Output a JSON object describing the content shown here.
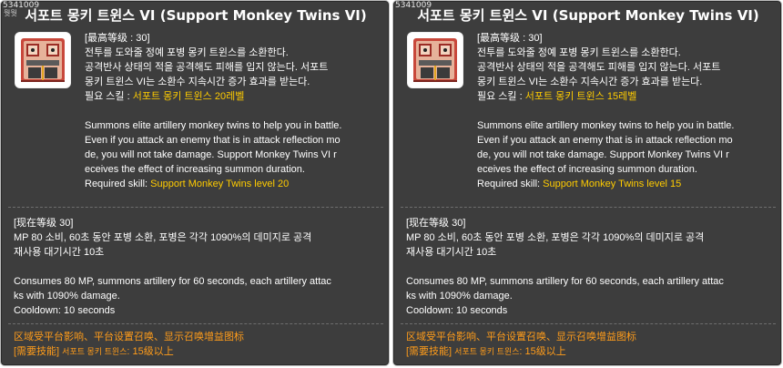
{
  "panels": [
    {
      "skill_id": "5341009",
      "skill_id_sub": "뭣뭣",
      "title": "서포트 몽키 트윈스 VI (Support Monkey Twins VI)",
      "desc_lines": {
        "max_level": "[最高等级 : 30]",
        "kr1": "전투를 도와줄 정예 포병 몽키 트윈스를 소환한다.",
        "kr2": "공격반사 상태의 적을 공격해도 피해를 입지 않는다. 서포트",
        "kr3": "몽키 트윈스 VI는 소환수 지속시간 증가 효과를 받는다.",
        "kr_req_prefix": "필요 스킬 : ",
        "kr_req_value": "서포트 몽키 트윈스 20레벨",
        "en1": "Summons elite artillery monkey twins to help you in battle.",
        "en2": "Even if you attack an enemy that is in attack reflection mo",
        "en3": "de, you will not take damage. Support Monkey Twins VI r",
        "en4": "eceives the effect of increasing summon duration.",
        "en_req_prefix": "Required skill: ",
        "en_req_value": "Support Monkey Twins level 20"
      },
      "level": {
        "current_level": "[现在等级 30]",
        "kr1": "MP 80 소비, 60초 동안 포병 소환, 포병은 각각 1090%의 데미지로 공격",
        "kr2": "재사용 대기시간 10초",
        "en1": "Consumes 80 MP, summons artillery for 60 seconds, each artillery attac",
        "en2": "ks with 1090% damage.",
        "en3": "Cooldown: 10 seconds"
      },
      "footer": {
        "line1": "区域受平台影响、平台设置召唤、显示召唤增益图标",
        "line2_prefix": "[需要技能] ",
        "line2_skill": "서포트 몽키 트윈스",
        "line2_suffix": ": 15级以上"
      }
    },
    {
      "skill_id": "5341009",
      "skill_id_sub": "",
      "title": "서포트 몽키 트윈스 VI (Support Monkey Twins VI)",
      "desc_lines": {
        "max_level": "[最高等级 : 30]",
        "kr1": "전투를 도와줄 정예 포병 몽키 트윈스를 소환한다.",
        "kr2": "공격반사 상태의 적을 공격해도 피해를 입지 않는다. 서포트",
        "kr3": "몽키 트윈스 VI는 소환수 지속시간 증가 효과를 받는다.",
        "kr_req_prefix": "필요 스킬 : ",
        "kr_req_value": "서포트 몽키 트윈스 15레벨",
        "en1": "Summons elite artillery monkey twins to help you in battle.",
        "en2": "Even if you attack an enemy that is in attack reflection mo",
        "en3": "de, you will not take damage. Support Monkey Twins VI r",
        "en4": "eceives the effect of increasing summon duration.",
        "en_req_prefix": "Required skill: ",
        "en_req_value": "Support Monkey Twins level 15"
      },
      "level": {
        "current_level": "[现在等级 30]",
        "kr1": "MP 80 소비, 60초 동안 포병 소환, 포병은 각각 1090%의 데미지로 공격",
        "kr2": "재사용 대기시간 10초",
        "en1": "Consumes 80 MP, summons artillery for 60 seconds, each artillery attac",
        "en2": "ks with 1090% damage.",
        "en3": "Cooldown: 10 seconds"
      },
      "footer": {
        "line1": "区域受平台影响、平台设置召唤、显示召唤增益图标",
        "line2_prefix": "[需要技能] ",
        "line2_skill": "서포트 몽키 트윈스",
        "line2_suffix": ": 15级以上"
      }
    }
  ],
  "colors": {
    "panel_bg": "#3d3d3d",
    "text": "#ffffff",
    "required_value": "#ffcc00",
    "footer": "#ff9c1a"
  },
  "icons": {
    "skill_icon": "support-monkey-twins-skill-icon"
  }
}
